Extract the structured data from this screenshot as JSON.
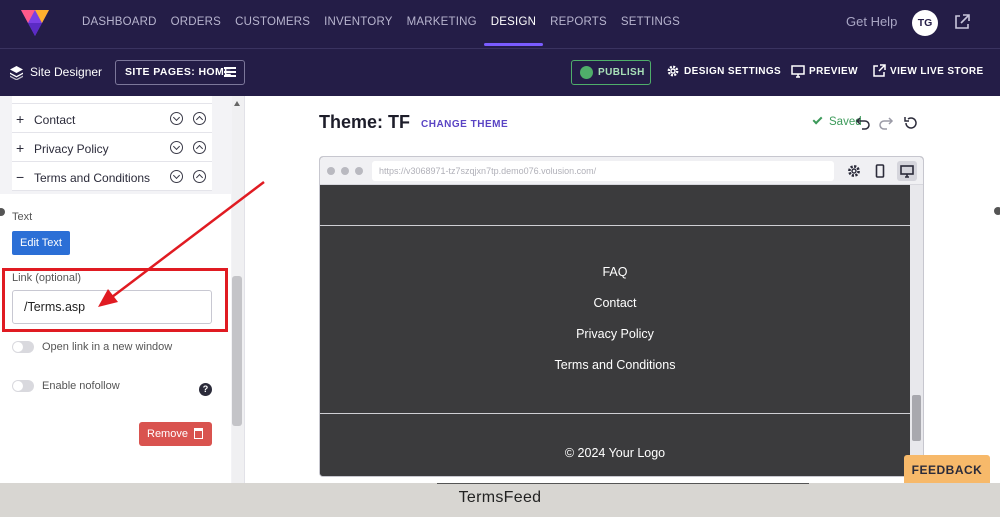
{
  "nav": {
    "items": [
      {
        "label": "DASHBOARD",
        "active": false
      },
      {
        "label": "ORDERS",
        "active": false
      },
      {
        "label": "CUSTOMERS",
        "active": false
      },
      {
        "label": "INVENTORY",
        "active": false
      },
      {
        "label": "MARKETING",
        "active": false
      },
      {
        "label": "DESIGN",
        "active": true
      },
      {
        "label": "REPORTS",
        "active": false
      },
      {
        "label": "SETTINGS",
        "active": false
      }
    ],
    "get_help": "Get Help",
    "avatar_initials": "TG"
  },
  "designbar": {
    "title": "Site Designer",
    "site_pages": "SITE PAGES: HOME",
    "publish": "PUBLISH",
    "design_settings": "DESIGN SETTINGS",
    "preview": "PREVIEW",
    "view_live_store": "VIEW LIVE STORE"
  },
  "left_panel": {
    "menu_items": [
      {
        "symbol": "+",
        "label": "Contact"
      },
      {
        "symbol": "+",
        "label": "Privacy Policy"
      },
      {
        "symbol": "−",
        "label": "Terms and Conditions"
      }
    ],
    "text_label": "Text",
    "edit_text_button": "Edit Text",
    "link_label": "Link (optional)",
    "link_value": "/Terms.asp",
    "open_new_window": "Open link in a new window",
    "enable_nofollow": "Enable nofollow",
    "help": "?",
    "remove_button": "Remove"
  },
  "main": {
    "theme_title": "Theme: TF",
    "change_theme": "CHANGE THEME",
    "saved": "Saved",
    "url": "https://v3068971-tz7szqjxn7tp.demo076.volusion.com/",
    "footer_links": [
      "FAQ",
      "Contact",
      "Privacy Policy",
      "Terms and Conditions"
    ],
    "copyright": "© 2024 Your Logo"
  },
  "feedback": "FEEDBACK",
  "watermark": "TermsFeed",
  "colors": {
    "nav_bg": "#241d47",
    "accent": "#7a5cff",
    "publish_green": "#4fae6a",
    "annotation_red": "#e01b22",
    "edit_blue": "#2b6fd6",
    "remove_red": "#d9534f",
    "site_bg": "#3b3b3d",
    "feedback_orange": "#f7b96a"
  }
}
